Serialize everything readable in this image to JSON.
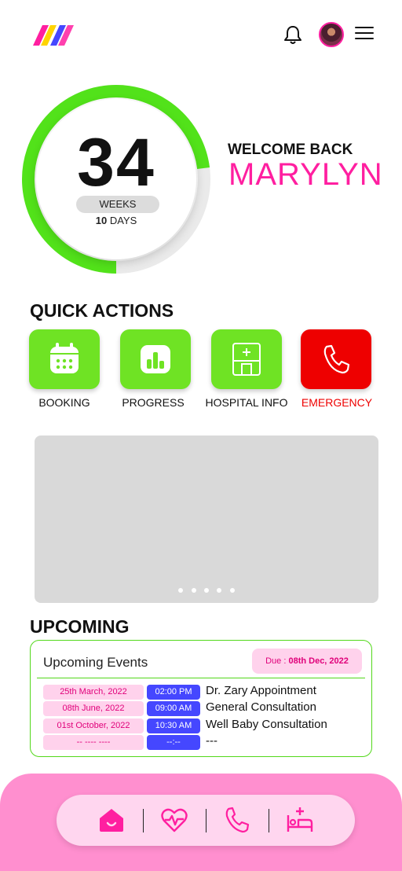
{
  "header": {
    "logo_icon": "m-logo-icon",
    "notification_icon": "bell-icon",
    "avatar_icon": "user-avatar",
    "menu_icon": "hamburger-menu-icon"
  },
  "progress": {
    "weeks": "34",
    "weeks_label": "WEEKS",
    "days": "10",
    "days_label": "DAYS",
    "ring_fraction": 0.73,
    "ring_color": "#52e21a"
  },
  "welcome": {
    "line1": "WELCOME BACK",
    "name": "MARYLYN"
  },
  "quick_actions": {
    "title": "QUICK ACTIONS",
    "items": [
      {
        "label": "BOOKING",
        "icon": "calendar-icon",
        "color": "#6fe324"
      },
      {
        "label": "PROGRESS",
        "icon": "bar-chart-icon",
        "color": "#6fe324"
      },
      {
        "label": "HOSPITAL INFO",
        "icon": "hospital-icon",
        "color": "#6fe324"
      },
      {
        "label": "EMERGENCY",
        "icon": "phone-icon",
        "color": "#ee0000"
      }
    ]
  },
  "banner": {
    "slide_count": 5
  },
  "upcoming": {
    "title": "UPCOMING",
    "card_title": "Upcoming Events",
    "due_prefix": "Due : ",
    "due_date": "08th Dec, 2022",
    "events": [
      {
        "date": "25th March, 2022",
        "time": "02:00 PM",
        "name": "Dr. Zary Appointment"
      },
      {
        "date": "08th June, 2022",
        "time": "09:00 AM",
        "name": "General Consultation"
      },
      {
        "date": "01st October, 2022",
        "time": "10:30 AM",
        "name": "Well Baby Consultation"
      },
      {
        "date": "-- ---- ----",
        "time": "--:--",
        "name": "---"
      }
    ]
  },
  "bottom_nav": {
    "items": [
      {
        "icon": "home-icon",
        "active": true
      },
      {
        "icon": "heart-pulse-icon",
        "active": false
      },
      {
        "icon": "phone-icon",
        "active": false
      },
      {
        "icon": "bed-plus-icon",
        "active": false
      }
    ],
    "accent": "#ff1fa0"
  }
}
